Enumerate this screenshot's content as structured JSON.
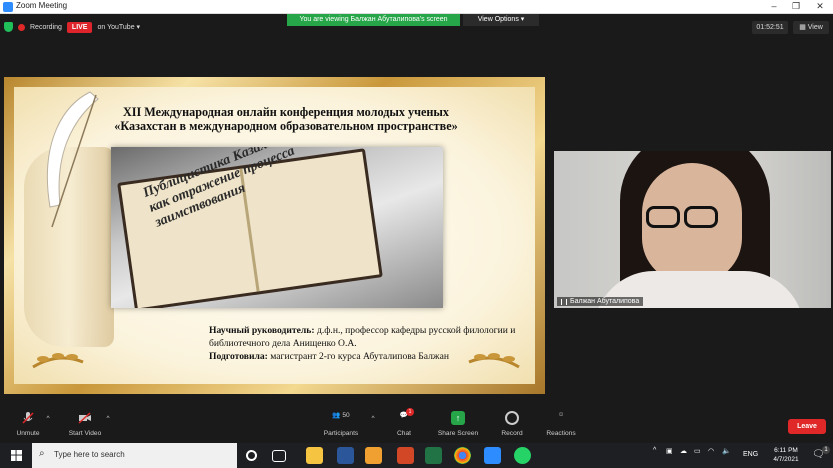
{
  "window": {
    "title": "Zoom Meeting"
  },
  "share_banner": {
    "viewing": "You are viewing Балжан Абуталипова's screen",
    "view_options": "View Options ▾"
  },
  "status": {
    "recording": "Recording",
    "live": "LIVE",
    "youtube": "on YouTube ▾"
  },
  "timer": "01:52:51",
  "view_label": "View",
  "slide": {
    "title_line1": "XII Международная онлайн конференция молодых ученых",
    "title_line2": "«Казахстан в международном образовательном пространстве»",
    "book_line1": "Публицистика Казахстана",
    "book_line2": "как отражение процесса",
    "book_line3": "заимствования",
    "supervisor_label": "Научный руководитель:",
    "supervisor_text": "д.ф.н., профессор кафедры русской филологии и библиотечного дела Анищенко О.А.",
    "prepared_label": "Подготовила:",
    "prepared_text": "магистрант 2-го курса Абуталипова Балжан"
  },
  "video": {
    "participant_name": "Балжан Абуталипова"
  },
  "toolbar": {
    "unmute": "Unmute",
    "start_video": "Start Video",
    "participants": "Participants",
    "participants_count": "50",
    "chat": "Chat",
    "chat_badge": "1",
    "share_screen": "Share Screen",
    "record": "Record",
    "reactions": "Reactions",
    "leave": "Leave"
  },
  "taskbar": {
    "search_placeholder": "Type here to search",
    "lang": "ENG",
    "time": "6:11 PM",
    "date": "4/7/2021",
    "notification_count": "1"
  }
}
